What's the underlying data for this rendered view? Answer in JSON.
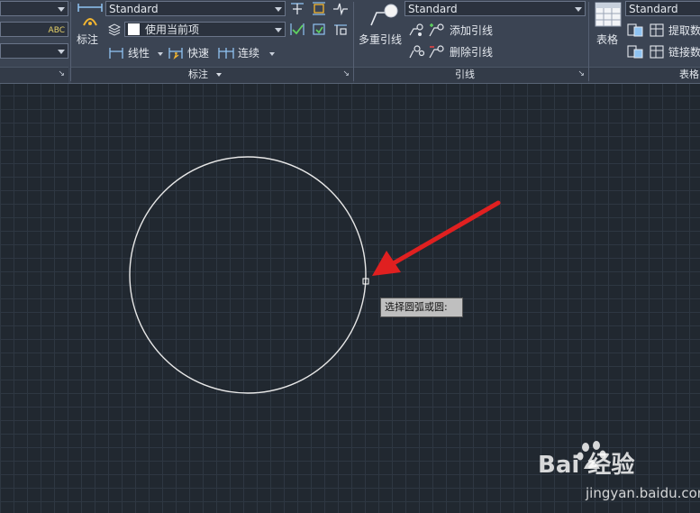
{
  "ribbon": {
    "annotation_panel": {
      "big_button_label": "标注",
      "dim_style_value": "Standard",
      "layer_value": "使用当前项",
      "linear_label": "线性",
      "quick_label": "快速",
      "continue_label": "连续",
      "title": "标注"
    },
    "leaders_panel": {
      "big_button_label": "多重引线",
      "style_value": "Standard",
      "add_label": "添加引线",
      "remove_label": "删除引线",
      "title": "引线"
    },
    "tables_panel": {
      "big_button_label": "表格",
      "style_value": "Standard",
      "extract_label": "提取数",
      "link_label": "链接数",
      "title": "表格"
    }
  },
  "canvas": {
    "tooltip_text": "选择圆弧或圆:",
    "circle_color": "#e8e8e8",
    "arrow_color": "#e02020"
  },
  "watermark": {
    "brand_text": "Bai 经验",
    "url_text": "jingyan.baidu.com"
  }
}
